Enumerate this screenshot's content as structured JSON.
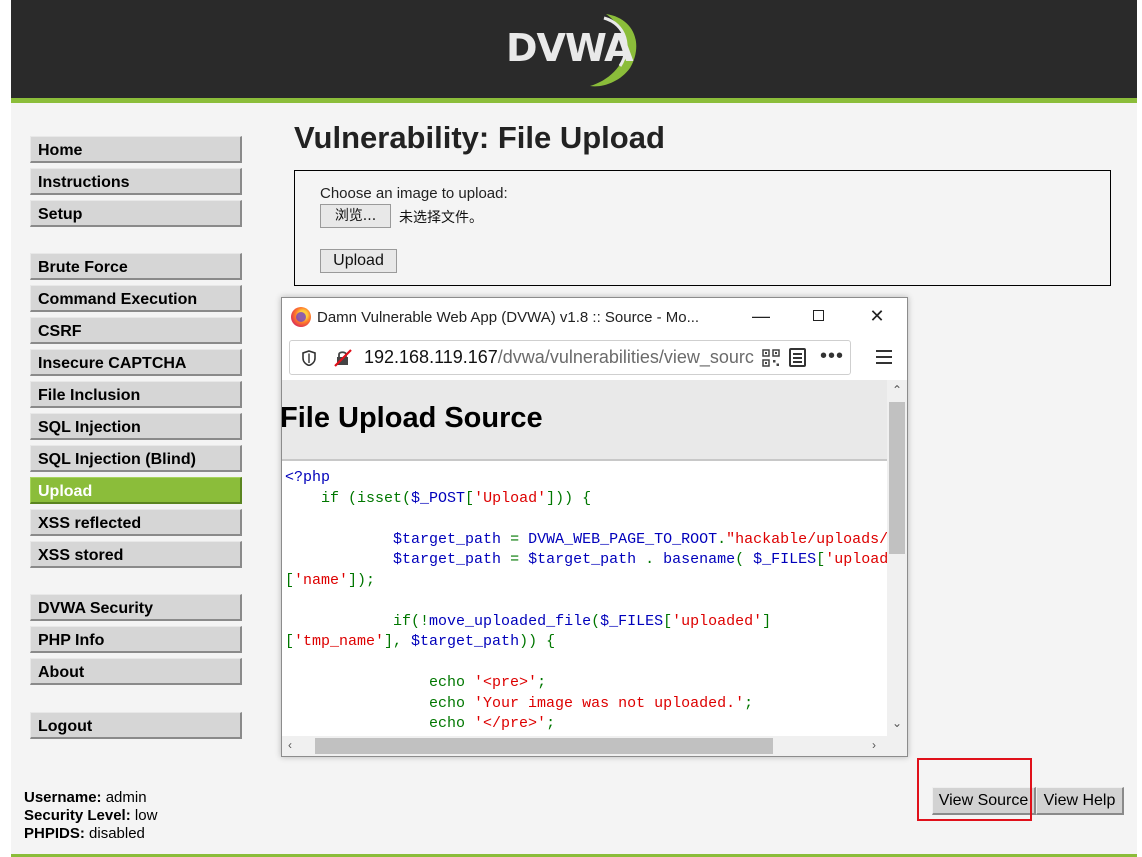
{
  "header": {
    "logo_text": "DVWA"
  },
  "menu": {
    "items": [
      {
        "label": "Home",
        "top": 0
      },
      {
        "label": "Instructions"
      },
      {
        "label": "Setup"
      },
      {
        "label": "Brute Force"
      },
      {
        "label": "Command Execution"
      },
      {
        "label": "CSRF"
      },
      {
        "label": "Insecure CAPTCHA"
      },
      {
        "label": "File Inclusion"
      },
      {
        "label": "SQL Injection"
      },
      {
        "label": "SQL Injection (Blind)"
      },
      {
        "label": "Upload",
        "selected": true
      },
      {
        "label": "XSS reflected"
      },
      {
        "label": "XSS stored"
      },
      {
        "label": "DVWA Security"
      },
      {
        "label": "PHP Info"
      },
      {
        "label": "About"
      },
      {
        "label": "Logout"
      }
    ]
  },
  "user_info": {
    "username_label": "Username:",
    "username": "admin",
    "security_label": "Security Level:",
    "security": "low",
    "phpids_label": "PHPIDS:",
    "phpids": "disabled"
  },
  "main": {
    "title": "Vulnerability: File Upload",
    "upload_label": "Choose an image to upload:",
    "browse_label": "浏览...",
    "no_file_text": "未选择文件。",
    "upload_button": "Upload",
    "view_source_button": "View Source",
    "view_help_button": "View Help"
  },
  "popup": {
    "window_title": "Damn Vulnerable Web App (DVWA) v1.8 :: Source - Mo...",
    "url_host": "192.168.119.167",
    "url_path": "/dvwa/vulnerabilities/view_sourc",
    "source_title": "File Upload Source"
  },
  "colors": {
    "accent_green": "#8bbd3a",
    "header_dark": "#2a2a2a",
    "highlight_red": "#e0101a"
  }
}
